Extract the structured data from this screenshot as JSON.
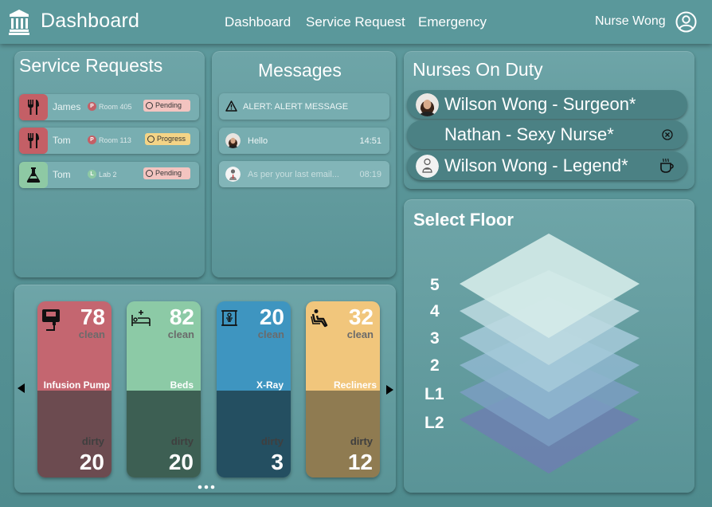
{
  "app": {
    "title": "Dashboard",
    "user_name": "Nurse Wong"
  },
  "nav": [
    {
      "label": "Dashboard"
    },
    {
      "label": "Service Request"
    },
    {
      "label": "Emergency"
    }
  ],
  "service_requests": {
    "title": "Service Requests",
    "items": [
      {
        "name": "James",
        "room_badge": "P",
        "room": "Room 405",
        "status": "Pending",
        "icon": "utensils-icon",
        "icon_bg": "#c45f66",
        "badge_color": "#c45f66",
        "status_bg": "#f3c4c0"
      },
      {
        "name": "Tom",
        "room_badge": "P",
        "room": "Room 113",
        "status": "Progress",
        "icon": "utensils-icon",
        "icon_bg": "#c45f66",
        "badge_color": "#c45f66",
        "status_bg": "#f4d486"
      },
      {
        "name": "Tom",
        "room_badge": "L",
        "room": "Lab 2",
        "status": "Pending",
        "icon": "flask-icon",
        "icon_bg": "#8ec9a4",
        "badge_color": "#8ec9a4",
        "status_bg": "#f3c4c0"
      }
    ]
  },
  "messages": {
    "title": "Messages",
    "items": [
      {
        "text": "ALERT: ALERT MESSAGE",
        "time": "",
        "icon": "warning-icon"
      },
      {
        "text": "Hello",
        "time": "14:51",
        "icon": "avatar"
      },
      {
        "text": "As per your last email...",
        "time": "08:19",
        "icon": "avatar"
      }
    ]
  },
  "nurses": {
    "title": "Nurses On Duty",
    "items": [
      {
        "name": "Wilson Wong - Surgeon*",
        "icon": "avatar",
        "status_icon": ""
      },
      {
        "name": "Nathan - Sexy Nurse*",
        "icon": "",
        "status_icon": "close-circle-icon"
      },
      {
        "name": "Wilson Wong - Legend*",
        "icon": "avatar",
        "status_icon": "coffee-icon"
      }
    ]
  },
  "equipment": {
    "clean_label": "clean",
    "dirty_label": "dirty",
    "items": [
      {
        "name": "Infusion Pump",
        "clean": "78",
        "dirty": "20",
        "icon": "infusion-pump-icon",
        "top_color": "#c46670",
        "bottom_color": "#6c4b50"
      },
      {
        "name": "Beds",
        "clean": "82",
        "dirty": "20",
        "icon": "bed-icon",
        "top_color": "#8ccaa6",
        "bottom_color": "#3d5f53"
      },
      {
        "name": "X-Ray",
        "clean": "20",
        "dirty": "3",
        "icon": "xray-icon",
        "top_color": "#3e95c0",
        "bottom_color": "#244f61"
      },
      {
        "name": "Recliners",
        "clean": "32",
        "dirty": "12",
        "icon": "recliner-icon",
        "top_color": "#f1c67c",
        "bottom_color": "#8f7b51"
      }
    ]
  },
  "floors": {
    "title": "Select Floor",
    "levels": [
      "5",
      "4",
      "3",
      "2",
      "L1",
      "L2"
    ]
  }
}
